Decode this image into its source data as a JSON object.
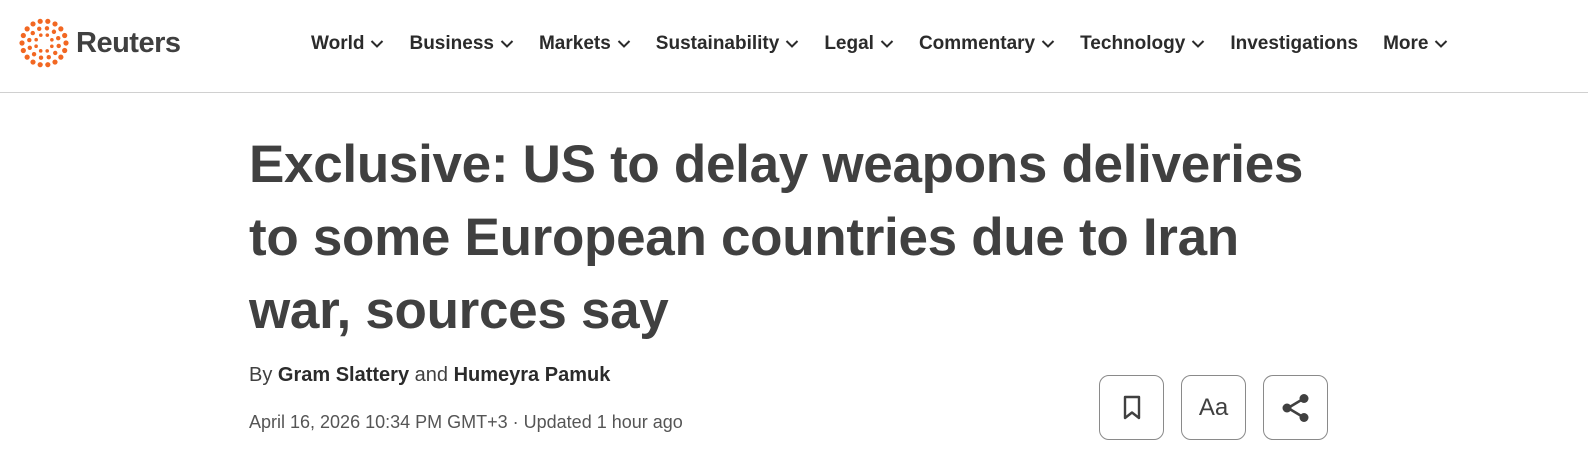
{
  "brand": {
    "name": "Reuters",
    "accent_color": "#f26722",
    "icon": "reuters-logo-icon"
  },
  "nav": {
    "items": [
      {
        "label": "World",
        "has_dropdown": true
      },
      {
        "label": "Business",
        "has_dropdown": true
      },
      {
        "label": "Markets",
        "has_dropdown": true
      },
      {
        "label": "Sustainability",
        "has_dropdown": true
      },
      {
        "label": "Legal",
        "has_dropdown": true
      },
      {
        "label": "Commentary",
        "has_dropdown": true
      },
      {
        "label": "Technology",
        "has_dropdown": true
      },
      {
        "label": "Investigations",
        "has_dropdown": false
      },
      {
        "label": "More",
        "has_dropdown": true
      }
    ]
  },
  "article": {
    "headline_lines": [
      "Exclusive: US to delay weapons deliveries",
      "to some European countries due to Iran",
      "war, sources say"
    ],
    "byline_prefix": "By",
    "author_1": "Gram Slattery",
    "byline_conjunction": "and",
    "author_2": "Humeyra Pamuk",
    "date": "April 16, 2026 10:34 PM GMT+3",
    "updated": "· Updated 1 hour ago"
  },
  "tools": {
    "bookmark_icon": "bookmark-icon",
    "font_size_label": "Aa",
    "share_icon": "share-icon"
  }
}
